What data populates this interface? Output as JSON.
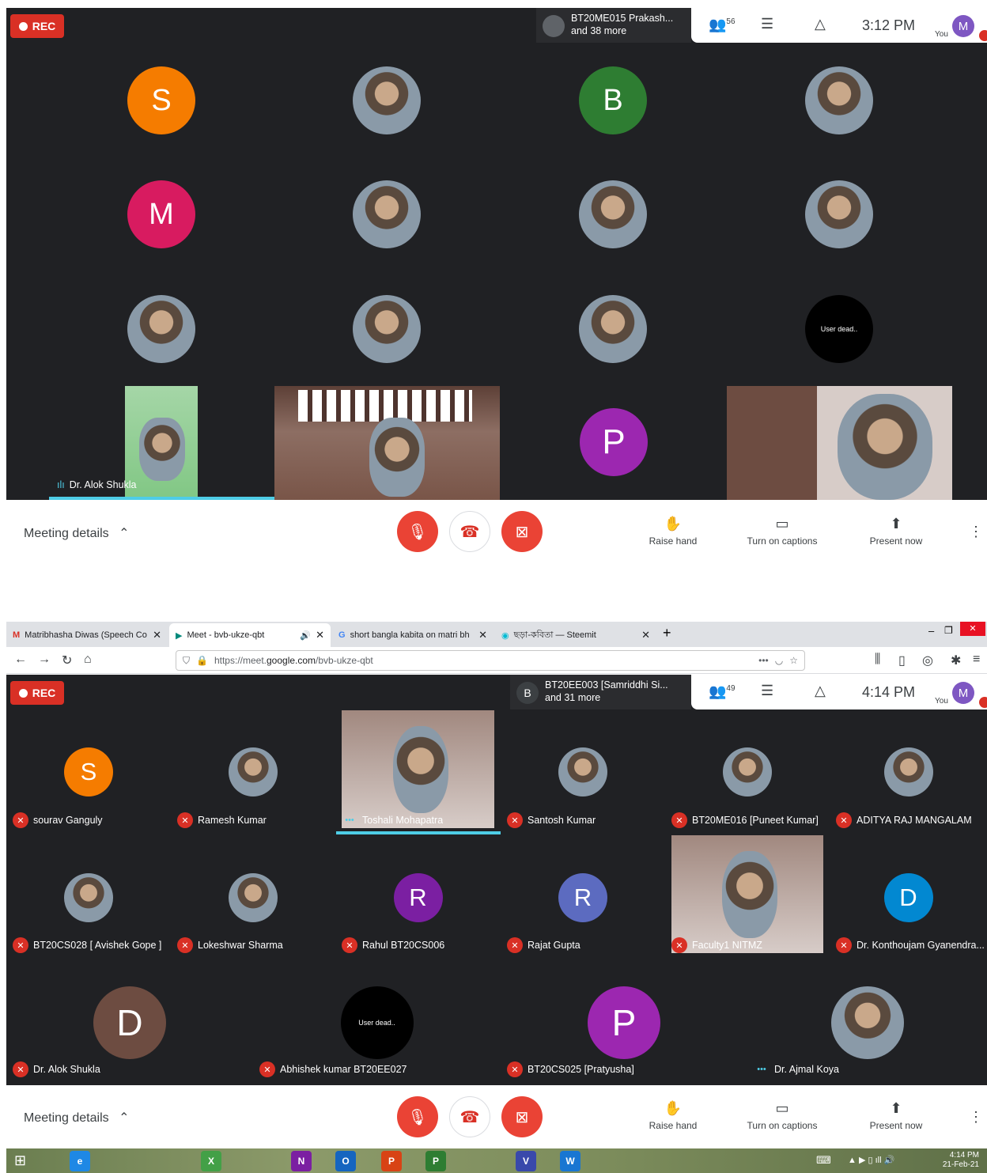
{
  "top": {
    "rec_label": "REC",
    "presenter_line1": "BT20ME015 Prakash...",
    "presenter_line2": "and 38 more",
    "people_count": "56",
    "time": "3:12 PM",
    "you_label": "You",
    "you_initial": "M",
    "tiles": [
      {
        "initial": "S",
        "color": "#f57c00"
      },
      {
        "initial": "",
        "color": "#cfd8dc"
      },
      {
        "initial": "B",
        "color": "#2e7d32"
      },
      {
        "initial": "",
        "color": "#f5f5f5"
      },
      {
        "initial": "M",
        "color": "#d81b60"
      },
      {
        "initial": "",
        "color": "#455a64"
      },
      {
        "initial": "",
        "color": "#263238"
      },
      {
        "initial": "",
        "color": "#ef9a9a"
      },
      {
        "initial": "",
        "color": "#8d6e63"
      },
      {
        "initial": "",
        "color": "#a1887f"
      },
      {
        "initial": "",
        "color": "#bcaaa4"
      },
      {
        "initial": "User dead..",
        "color": "#000000"
      }
    ],
    "speaker_label": "Dr. Alok Shukla",
    "p_initial": "P",
    "p_color": "#9c27b0",
    "controls": {
      "meeting_details": "Meeting details",
      "raise_hand": "Raise hand",
      "captions": "Turn on captions",
      "present": "Present now"
    }
  },
  "browser": {
    "tabs": [
      {
        "title": "Matribhasha Diwas (Speech Co",
        "icon": "gmail-icon"
      },
      {
        "title": "Meet - bvb-ukze-qbt",
        "icon": "meet-icon"
      },
      {
        "title": "short bangla kabita on matri bh",
        "icon": "google-icon"
      },
      {
        "title": "ছড়া-কবিতা — Steemit",
        "icon": "steemit-icon"
      }
    ],
    "url_prefix": "https://meet.",
    "url_domain": "google.com",
    "url_path": "/bvb-ukze-qbt"
  },
  "bottom": {
    "rec_label": "REC",
    "presenter_initial": "B",
    "presenter_line1": "BT20EE003 [Samriddhi Si...",
    "presenter_line2": "and 31 more",
    "people_count": "49",
    "time": "4:14 PM",
    "you_label": "You",
    "you_initial": "M",
    "row1": [
      {
        "name": "sourav Ganguly",
        "initial": "S",
        "color": "#f57c00"
      },
      {
        "name": "Ramesh Kumar",
        "initial": "",
        "color": "#5d4037"
      },
      {
        "name": "Toshali Mohapatra",
        "initial": "",
        "color": "#9e9e9e"
      },
      {
        "name": "Santosh Kumar",
        "initial": "",
        "color": "#607d8b"
      },
      {
        "name": "BT20ME016 [Puneet Kumar]",
        "initial": "",
        "color": "#6d4c41"
      },
      {
        "name": "ADITYA RAJ MANGALAM",
        "initial": "",
        "color": "#424242"
      }
    ],
    "row2": [
      {
        "name": "BT20CS028 [ Avishek Gope ]",
        "initial": "",
        "color": "#78909c"
      },
      {
        "name": "Lokeshwar Sharma",
        "initial": "",
        "color": "#8d6e63"
      },
      {
        "name": "Rahul BT20CS006",
        "initial": "R",
        "color": "#7b1fa2"
      },
      {
        "name": "Rajat Gupta",
        "initial": "R",
        "color": "#5c6bc0"
      },
      {
        "name": "Faculty1 NITMZ",
        "initial": "",
        "color": "#9e9e9e"
      },
      {
        "name": "Dr. Konthoujam Gyanendra...",
        "initial": "D",
        "color": "#0288d1"
      }
    ],
    "row3": [
      {
        "name": "Dr. Alok Shukla",
        "initial": "D",
        "color": "#6d4c41"
      },
      {
        "name": "Abhishek kumar BT20EE027",
        "initial": "User dead..",
        "color": "#000000"
      },
      {
        "name": "BT20CS025 [Pratyusha]",
        "initial": "P",
        "color": "#9c27b0"
      },
      {
        "name": "Dr. Ajmal Koya",
        "initial": "",
        "color": "#546e7a"
      }
    ],
    "controls": {
      "meeting_details": "Meeting details",
      "raise_hand": "Raise hand",
      "captions": "Turn on captions",
      "present": "Present now"
    }
  },
  "taskbar": {
    "time": "4:14 PM",
    "date": "21-Feb-21",
    "apps": [
      "e",
      "X",
      "N",
      "O",
      "P",
      "P",
      "V",
      "W"
    ]
  }
}
